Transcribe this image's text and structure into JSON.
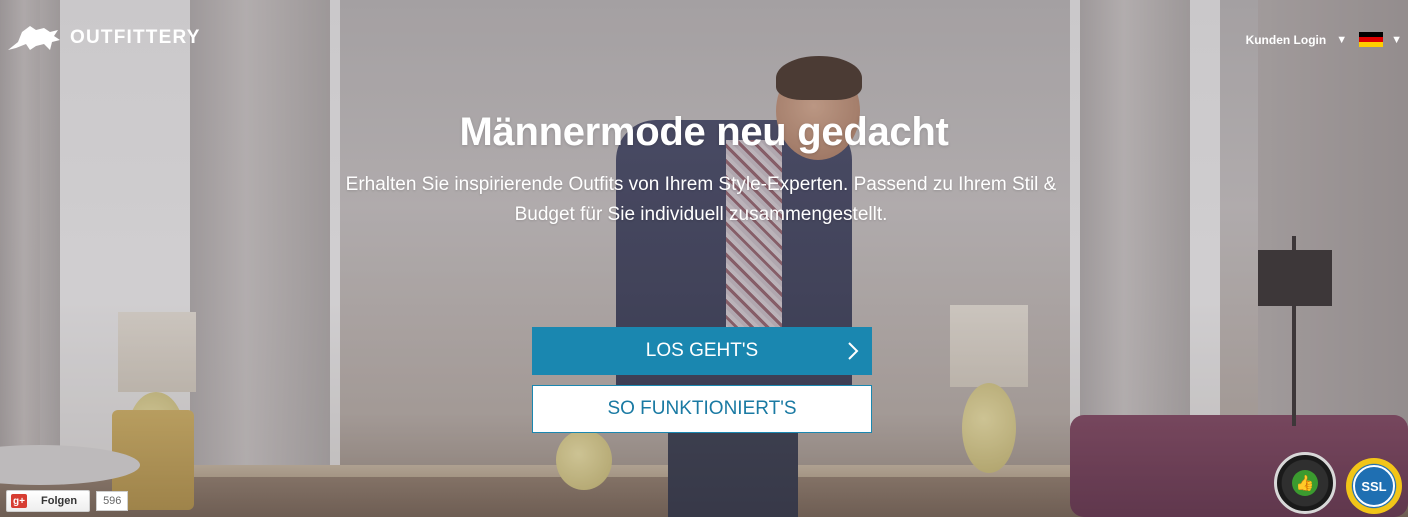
{
  "header": {
    "logo_text": "OUTFITTERY",
    "login_label": "Kunden Login",
    "login_caret": "▼",
    "language_caret": "▼",
    "flag_colors": [
      "#000000",
      "#dd0000",
      "#ffce00"
    ]
  },
  "hero": {
    "headline": "Männermode neu gedacht",
    "subline": "Erhalten Sie inspirierende Outfits von Ihrem Style-Experten. Passend zu Ihrem Stil & Budget für Sie individuell zusammengestellt.",
    "primary_button": "LOS GEHT'S",
    "primary_button_chevron": "›",
    "secondary_button": "SO FUNKTIONIERT'S"
  },
  "social": {
    "gplus_icon": "g+",
    "follow_label": "Folgen",
    "follow_count": "596"
  },
  "badges": {
    "ssl_label": "SSL"
  },
  "colors": {
    "accent": "#1a87b0",
    "text_on_image": "#ffffff"
  }
}
